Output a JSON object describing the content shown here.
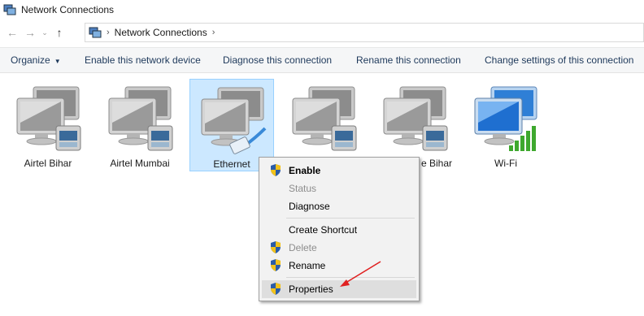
{
  "window": {
    "title": "Network Connections"
  },
  "address": {
    "path": "Network Connections"
  },
  "toolbar": {
    "organize": "Organize",
    "enable": "Enable this network device",
    "diagnose": "Diagnose this connection",
    "rename": "Rename this connection",
    "change": "Change settings of this connection"
  },
  "connections": [
    {
      "label": "Airtel Bihar",
      "icon": "network-device-icon"
    },
    {
      "label": "Airtel Mumbai",
      "icon": "network-device-icon"
    },
    {
      "label": "Ethernet",
      "icon": "ethernet-adapter-icon"
    },
    {
      "label": "",
      "icon": "network-device-icon"
    },
    {
      "label": "e Bihar",
      "icon": "network-device-icon"
    },
    {
      "label": "Wi-Fi",
      "icon": "wifi-adapter-icon"
    }
  ],
  "context_menu": {
    "items": [
      {
        "label": "Enable",
        "state": "default"
      },
      {
        "label": "Status",
        "state": "disabled"
      },
      {
        "label": "Diagnose",
        "state": "normal"
      },
      {
        "label": "Create Shortcut",
        "state": "normal"
      },
      {
        "label": "Delete",
        "state": "disabled"
      },
      {
        "label": "Rename",
        "state": "normal"
      },
      {
        "label": "Properties",
        "state": "highlighted"
      }
    ]
  },
  "colors": {
    "selection": "#cce8ff",
    "selection_border": "#99d1ff",
    "arrow": "#e02020",
    "toolbar_text": "#1e395b"
  }
}
